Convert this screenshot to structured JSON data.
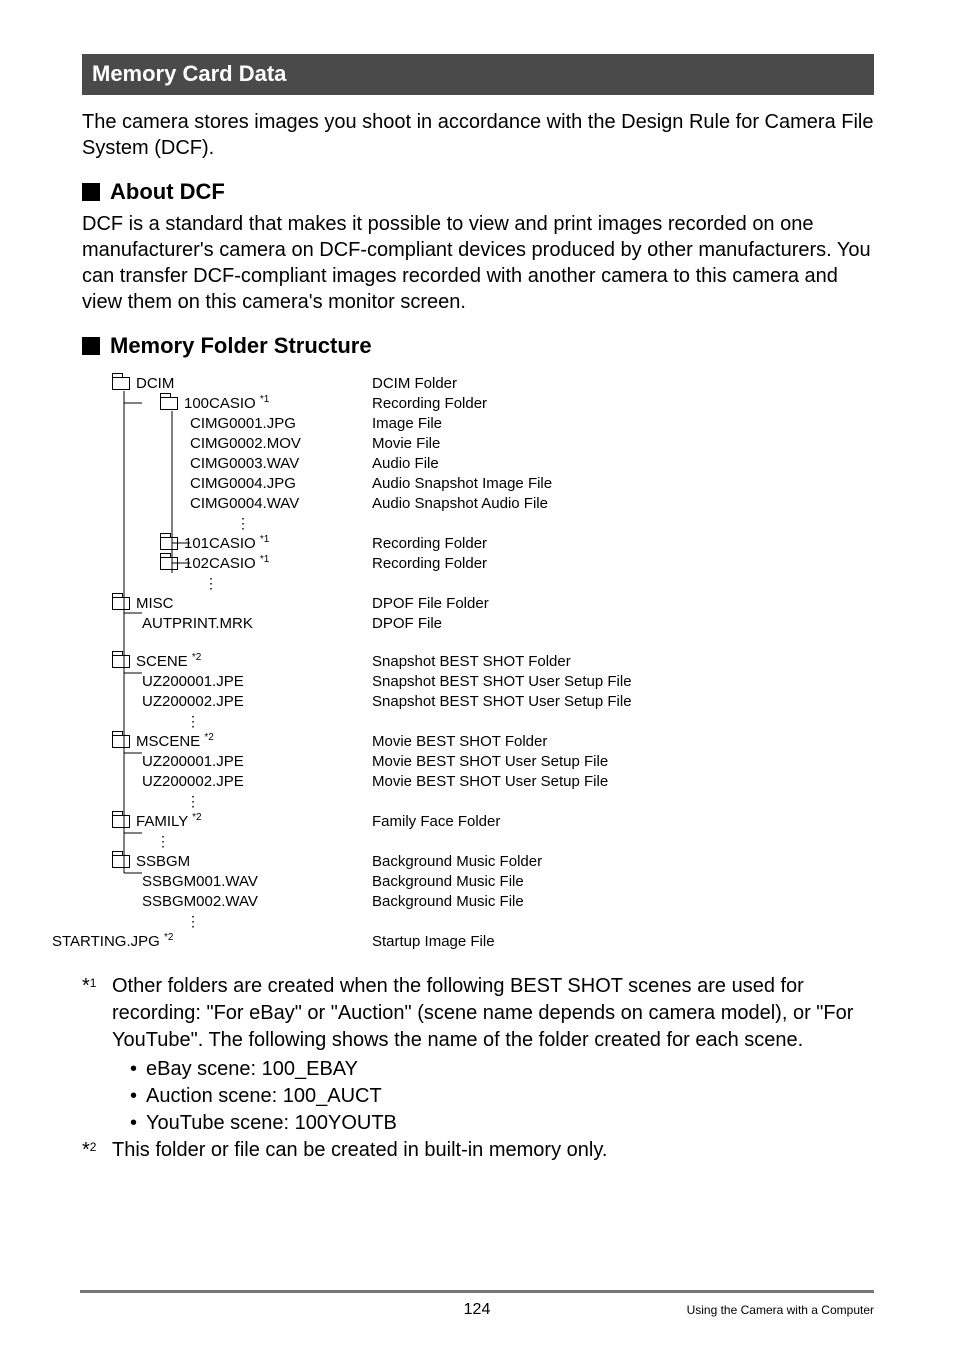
{
  "banner": {
    "title": "Memory Card Data"
  },
  "intro": "The camera stores images you shoot in accordance with the Design Rule for Camera File System (DCF).",
  "section_about": {
    "heading": "About DCF",
    "body": "DCF is a standard that makes it possible to view and print images recorded on one manufacturer's camera on DCF-compliant devices produced by other manufacturers. You can transfer DCF-compliant images recorded with another camera to this camera and view them on this camera's monitor screen."
  },
  "section_tree": {
    "heading": "Memory Folder Structure"
  },
  "tree": {
    "r0": {
      "name": "DCIM",
      "desc": "DCIM Folder"
    },
    "r1": {
      "name": "100CASIO ",
      "sup": "*1",
      "desc": "Recording Folder"
    },
    "r2": {
      "name": "CIMG0001.JPG",
      "desc": "Image File"
    },
    "r3": {
      "name": "CIMG0002.MOV",
      "desc": "Movie File"
    },
    "r4": {
      "name": "CIMG0003.WAV",
      "desc": "Audio File"
    },
    "r5": {
      "name": "CIMG0004.JPG",
      "desc": "Audio Snapshot Image File"
    },
    "r6": {
      "name": "CIMG0004.WAV",
      "desc": "Audio Snapshot Audio File"
    },
    "r7": {
      "dots": "⋮"
    },
    "r8": {
      "name": "101CASIO ",
      "sup": "*1",
      "desc": "Recording Folder"
    },
    "r9": {
      "name": "102CASIO ",
      "sup": "*1",
      "desc": "Recording Folder"
    },
    "r10": {
      "dots": "⋮"
    },
    "r11": {
      "name": "MISC",
      "desc": "DPOF File Folder"
    },
    "r12": {
      "name": "AUTPRINT.MRK",
      "desc": "DPOF File"
    },
    "r14": {
      "name": "SCENE ",
      "sup": "*2",
      "desc": "Snapshot BEST SHOT Folder"
    },
    "r15": {
      "name": "UZ200001.JPE",
      "desc": "Snapshot BEST SHOT User Setup File"
    },
    "r16": {
      "name": "UZ200002.JPE",
      "desc": "Snapshot BEST SHOT User Setup File"
    },
    "r17": {
      "dots": "⋮"
    },
    "r18": {
      "name": "MSCENE ",
      "sup": "*2",
      "desc": "Movie BEST SHOT Folder"
    },
    "r19": {
      "name": "UZ200001.JPE",
      "desc": "Movie BEST SHOT User Setup File"
    },
    "r20": {
      "name": "UZ200002.JPE",
      "desc": "Movie BEST SHOT User Setup File"
    },
    "r21": {
      "dots": "⋮"
    },
    "r22": {
      "name": "FAMILY ",
      "sup": "*2",
      "desc": "Family Face Folder"
    },
    "r23": {
      "dots": "⋮"
    },
    "r24": {
      "name": "SSBGM",
      "desc": "Background Music Folder"
    },
    "r25": {
      "name": "SSBGM001.WAV",
      "desc": "Background Music File"
    },
    "r26": {
      "name": "SSBGM002.WAV",
      "desc": "Background Music File"
    },
    "r27": {
      "dots": "⋮"
    },
    "r28": {
      "name": "STARTING.JPG ",
      "sup": "*2",
      "desc": "Startup Image File"
    }
  },
  "notes": {
    "n1": {
      "mark": "*",
      "sup": "1",
      "text": "Other folders are created when the following BEST SHOT scenes are used for recording: \"For eBay\" or \"Auction\" (scene name depends on camera model), or \"For YouTube\". The following shows the name of the folder created for each scene.",
      "b1": "eBay scene: 100_EBAY",
      "b2": "Auction scene: 100_AUCT",
      "b3": "YouTube scene: 100YOUTB"
    },
    "n2": {
      "mark": "*",
      "sup": "2",
      "text": "This folder or file can be created in built-in memory only."
    }
  },
  "footer": {
    "page": "124",
    "label": "Using the Camera with a Computer"
  }
}
